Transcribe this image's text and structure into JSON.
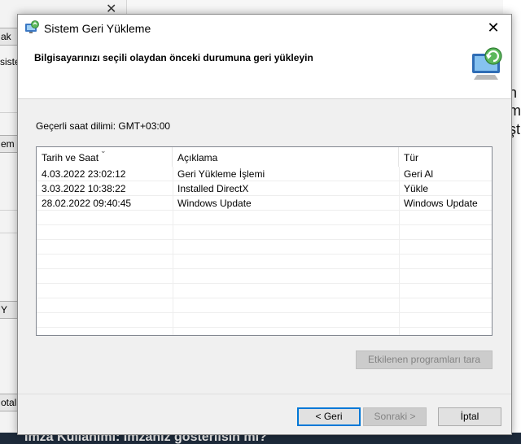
{
  "background": {
    "left_items": [
      "ak",
      "siste",
      "em",
      "Y",
      "otal"
    ],
    "right_items": [
      "n",
      "m",
      "şt"
    ],
    "bottom_text": "İmza Kullanımı: İmzanız gösterilsin mi?"
  },
  "dialog": {
    "title": "Sistem Geri Yükleme",
    "heading": "Bilgisayarınızı seçili olaydan önceki durumuna geri yükleyin",
    "timezone": "Geçerli saat dilimi: GMT+03:00",
    "columns": [
      "Tarih ve Saat",
      "Açıklama",
      "Tür"
    ],
    "rows": [
      {
        "date": "4.03.2022 23:02:12",
        "description": "Geri Yükleme İşlemi",
        "type": "Geri Al"
      },
      {
        "date": "3.03.2022 10:38:22",
        "description": "Installed DirectX",
        "type": "Yükle"
      },
      {
        "date": "28.02.2022 09:40:45",
        "description": "Windows Update",
        "type": "Windows Update"
      }
    ],
    "scan_button": "Etkilenen programları tara",
    "back_button": "< Geri",
    "next_button": "Sonraki >",
    "cancel_button": "İptal",
    "close_glyph": "✕"
  },
  "icons": [
    "system-restore-icon",
    "close-icon",
    "sort-arrow-icon"
  ],
  "colors": {
    "accent": "#0078d7",
    "disabled": "#838383"
  }
}
